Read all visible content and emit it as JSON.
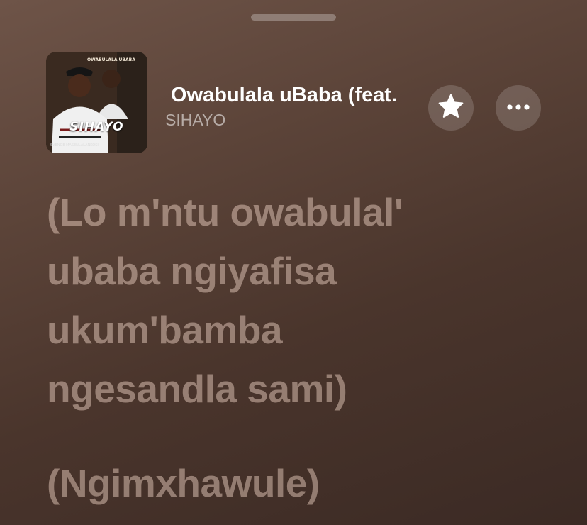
{
  "track": {
    "title": "Owabulala uBaba (feat.",
    "artist": "SIHAYO"
  },
  "artwork": {
    "title_text": "SIHAYO",
    "top_text": "OWABULALA UBABA",
    "bottom_text": "SVENGE MASENLALANKOSI"
  },
  "lyrics": {
    "stanza_1": [
      "(Lo m'ntu owabulal'",
      "ubaba ngiyafisa",
      "ukum'bamba",
      "ngesandla sami)"
    ],
    "stanza_2": [
      "(Ngimxhawule)"
    ]
  },
  "icons": {
    "favorite": "star-icon",
    "more": "ellipsis-icon"
  },
  "colors": {
    "background": "#5c4439",
    "lyric_text": "#ecd2c3",
    "button_bg": "rgba(255,255,255,0.16)"
  }
}
